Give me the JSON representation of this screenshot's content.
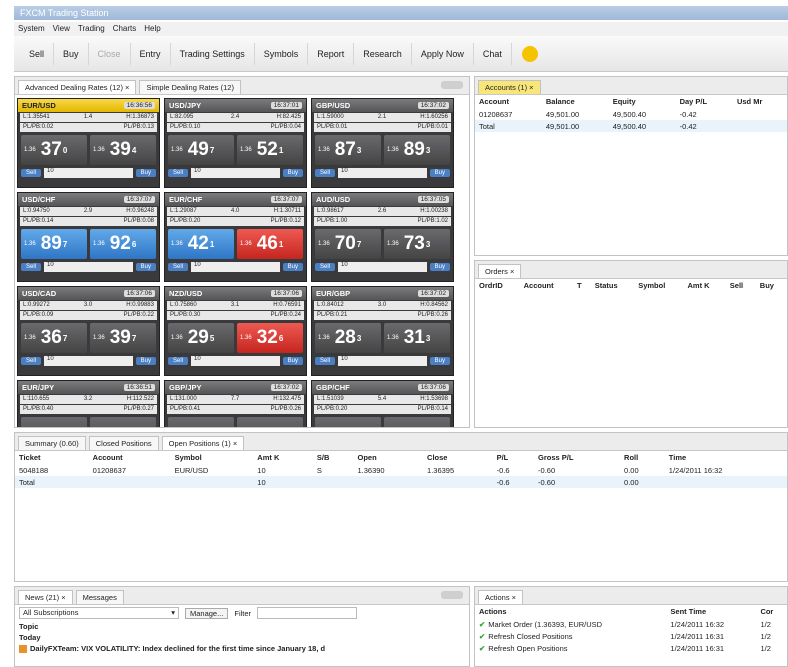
{
  "window": {
    "title": "FXCM Trading Station"
  },
  "menu": [
    "System",
    "View",
    "Trading",
    "Charts",
    "Help"
  ],
  "toolbar": [
    {
      "label": "Sell",
      "enabled": true
    },
    {
      "label": "Buy",
      "enabled": true
    },
    {
      "label": "Close",
      "enabled": false
    },
    {
      "label": "Entry",
      "enabled": true
    },
    {
      "label": "Trading Settings",
      "enabled": true
    },
    {
      "label": "Symbols",
      "enabled": true
    },
    {
      "label": "Report",
      "enabled": true
    },
    {
      "label": "Research",
      "enabled": true
    },
    {
      "label": "Apply Now",
      "enabled": true
    },
    {
      "label": "Chat",
      "enabled": true
    }
  ],
  "dealing": {
    "tabs": [
      "Advanced Dealing Rates (12) ×",
      "Simple Dealing Rates (12)"
    ],
    "tiles": [
      {
        "symbol": "EUR/USD",
        "time": "16:36:56",
        "low": "L:1.35541",
        "high": "H:1.36873",
        "spread": "1.4",
        "pips_l": "PL/PB:0.02",
        "pips_r": "PL/PB:0.13",
        "sell": "37",
        "sell_sup": "0",
        "buy": "39",
        "buy_sup": "4",
        "amount": "10",
        "sell_color": "gray",
        "buy_color": "gray",
        "highlight": true
      },
      {
        "symbol": "USD/JPY",
        "time": "16:37:01",
        "low": "L:82.095",
        "high": "H:82.425",
        "spread": "2.4",
        "pips_l": "PL/PB:0.10",
        "pips_r": "PL/PB:0.04",
        "sell": "49",
        "sell_sup": "7",
        "buy": "52",
        "buy_sup": "1",
        "amount": "10",
        "sell_color": "gray",
        "buy_color": "gray",
        "highlight": false
      },
      {
        "symbol": "GBP/USD",
        "time": "16:37:02",
        "low": "L:1.59000",
        "high": "H:1.60256",
        "spread": "2.1",
        "pips_l": "PL/PB:0.01",
        "pips_r": "PL/PB:0.01",
        "sell": "87",
        "sell_sup": "3",
        "buy": "89",
        "buy_sup": "3",
        "amount": "10",
        "sell_color": "gray",
        "buy_color": "gray",
        "highlight": false
      },
      {
        "symbol": "USD/CHF",
        "time": "16:37:07",
        "low": "L:0.94750",
        "high": "H:0.96248",
        "spread": "2.9",
        "pips_l": "PL/PB:0.14",
        "pips_r": "PL/PB:0.08",
        "sell": "89",
        "sell_sup": "7",
        "buy": "92",
        "buy_sup": "6",
        "amount": "10",
        "sell_color": "blue",
        "buy_color": "blue",
        "highlight": false
      },
      {
        "symbol": "EUR/CHF",
        "time": "16:37:07",
        "low": "L:1.29087",
        "high": "H:1.30711",
        "spread": "4.0",
        "pips_l": "PL/PB:0.20",
        "pips_r": "PL/PB:0.12",
        "sell": "42",
        "sell_sup": "1",
        "buy": "46",
        "buy_sup": "1",
        "amount": "10",
        "sell_color": "blue",
        "buy_color": "red",
        "highlight": false
      },
      {
        "symbol": "AUD/USD",
        "time": "16:37:05",
        "low": "L:0.98617",
        "high": "H:1.00238",
        "spread": "2.6",
        "pips_l": "PL/PB:1.00",
        "pips_r": "PL/PB:1.02",
        "sell": "70",
        "sell_sup": "7",
        "buy": "73",
        "buy_sup": "3",
        "amount": "10",
        "sell_color": "gray",
        "buy_color": "gray",
        "highlight": false
      },
      {
        "symbol": "USD/CAD",
        "time": "16:37:06",
        "low": "L:0.99272",
        "high": "H:0.99883",
        "spread": "3.0",
        "pips_l": "PL/PB:0.09",
        "pips_r": "PL/PB:0.22",
        "sell": "36",
        "sell_sup": "7",
        "buy": "39",
        "buy_sup": "7",
        "amount": "10",
        "sell_color": "gray",
        "buy_color": "gray",
        "highlight": false
      },
      {
        "symbol": "NZD/USD",
        "time": "16:37:06",
        "low": "L:0.75860",
        "high": "H:0.76591",
        "spread": "3.1",
        "pips_l": "PL/PB:0.30",
        "pips_r": "PL/PB:0.24",
        "sell": "29",
        "sell_sup": "5",
        "buy": "32",
        "buy_sup": "6",
        "amount": "10",
        "sell_color": "gray",
        "buy_color": "red",
        "highlight": false
      },
      {
        "symbol": "EUR/GBP",
        "time": "16:37:02",
        "low": "L:0.84012",
        "high": "H:0.84562",
        "spread": "3.0",
        "pips_l": "PL/PB:0.21",
        "pips_r": "PL/PB:0.26",
        "sell": "28",
        "sell_sup": "3",
        "buy": "31",
        "buy_sup": "3",
        "amount": "10",
        "sell_color": "gray",
        "buy_color": "gray",
        "highlight": false
      },
      {
        "symbol": "EUR/JPY",
        "time": "16:36:51",
        "low": "L:110.655",
        "high": "H:112.522",
        "spread": "3.2",
        "pips_l": "PL/PB:0.40",
        "pips_r": "PL/PB:0.27",
        "sell": "",
        "sell_sup": "",
        "buy": "",
        "buy_sup": "",
        "amount": "10",
        "sell_color": "gray",
        "buy_color": "gray",
        "highlight": false
      },
      {
        "symbol": "GBP/JPY",
        "time": "16:37:02",
        "low": "L:131.000",
        "high": "H:132.475",
        "spread": "7.7",
        "pips_l": "PL/PB:0.41",
        "pips_r": "PL/PB:0.26",
        "sell": "",
        "sell_sup": "",
        "buy": "",
        "buy_sup": "",
        "amount": "10",
        "sell_color": "gray",
        "buy_color": "gray",
        "highlight": false
      },
      {
        "symbol": "GBP/CHF",
        "time": "16:37:06",
        "low": "L:1.51039",
        "high": "H:1.53698",
        "spread": "5.4",
        "pips_l": "PL/PB:0.20",
        "pips_r": "PL/PB:0.14",
        "sell": "",
        "sell_sup": "",
        "buy": "",
        "buy_sup": "",
        "amount": "10",
        "sell_color": "gray",
        "buy_color": "gray",
        "highlight": false
      }
    ],
    "sell_label": "Sell",
    "buy_label": "Buy",
    "price_label": "1.36"
  },
  "accounts": {
    "tab": "Accounts (1) ×",
    "headers": [
      "Account",
      "Balance",
      "Equity",
      "Day P/L",
      "Usd Mr"
    ],
    "rows": [
      [
        "01208637",
        "49,501.00",
        "49,500.40",
        "-0.42",
        ""
      ],
      [
        "Total",
        "49,501.00",
        "49,500.40",
        "-0.42",
        ""
      ]
    ]
  },
  "orders": {
    "tab": "Orders ×",
    "headers": [
      "OrdrID",
      "Account",
      "T",
      "Status",
      "Symbol",
      "Amt K",
      "Sell",
      "Buy"
    ]
  },
  "positions": {
    "tabs": [
      "Summary (0.60)",
      "Closed Positions",
      "Open Positions (1) ×"
    ],
    "headers": [
      "Ticket",
      "Account",
      "Symbol",
      "Amt K",
      "S/B",
      "Open",
      "Close",
      "P/L",
      "Gross P/L",
      "Roll",
      "Time"
    ],
    "rows": [
      [
        "5048188",
        "01208637",
        "EUR/USD",
        "10",
        "S",
        "1.36390",
        "1.36395",
        "-0.6",
        "-0.60",
        "0.00",
        "1/24/2011 16:32"
      ],
      [
        "Total",
        "",
        "",
        "10",
        "",
        "",
        "",
        "-0.6",
        "-0.60",
        "0.00",
        ""
      ]
    ]
  },
  "news": {
    "tabs": [
      "News (21) ×",
      "Messages"
    ],
    "subscription": "All Subscriptions",
    "manage_label": "Manage...",
    "filter_label": "Filter",
    "filter_value": "",
    "topic_label": "Topic",
    "today_label": "Today",
    "headline": "DailyFXTeam: VIX VOLATILITY: Index declined for the first time since January 18, d"
  },
  "actions": {
    "tab": "Actions ×",
    "headers": [
      "Actions",
      "Sent Time",
      "Cor"
    ],
    "rows": [
      [
        "Market Order (1.36393, EUR/USD",
        "1/24/2011 16:32",
        "1/2"
      ],
      [
        "Refresh Closed Positions",
        "1/24/2011 16:31",
        "1/2"
      ],
      [
        "Refresh Open Positions",
        "1/24/2011 16:31",
        "1/2"
      ]
    ]
  }
}
